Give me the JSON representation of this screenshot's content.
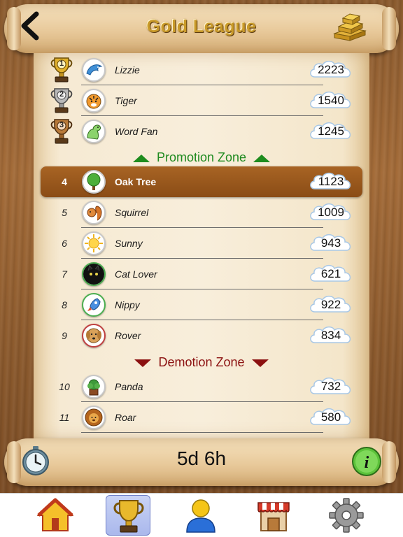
{
  "header": {
    "title": "Gold League",
    "back_icon": "chevron-left-icon",
    "currency_icon": "gold-bars-icon"
  },
  "leaderboard": {
    "top3": [
      {
        "rank": "1",
        "trophy": "gold",
        "name": "Lizzie",
        "score": "2223",
        "avatar": "dolphin"
      },
      {
        "rank": "2",
        "trophy": "silver",
        "name": "Tiger",
        "score": "1540",
        "avatar": "tiger"
      },
      {
        "rank": "3",
        "trophy": "bronze",
        "name": "Word Fan",
        "score": "1245",
        "avatar": "dinosaur"
      }
    ],
    "promotion_label": "Promotion Zone",
    "middle": [
      {
        "rank": "4",
        "name": "Oak Tree",
        "score": "1123",
        "avatar": "tree",
        "highlighted": true
      },
      {
        "rank": "5",
        "name": "Squirrel",
        "score": "1009",
        "avatar": "squirrel"
      },
      {
        "rank": "6",
        "name": "Sunny",
        "score": "943",
        "avatar": "sun"
      },
      {
        "rank": "7",
        "name": "Cat Lover",
        "score": "621",
        "avatar": "cat"
      },
      {
        "rank": "8",
        "name": "Nippy",
        "score": "922",
        "avatar": "rocket"
      },
      {
        "rank": "9",
        "name": "Rover",
        "score": "834",
        "avatar": "dog"
      }
    ],
    "demotion_label": "Demotion Zone",
    "bottom": [
      {
        "rank": "10",
        "name": "Panda",
        "score": "732",
        "avatar": "plant"
      },
      {
        "rank": "11",
        "name": "Roar",
        "score": "580",
        "avatar": "lion"
      }
    ]
  },
  "footer": {
    "time_left": "5d 6h",
    "timer_icon": "stopwatch-icon",
    "info_icon": "info-icon"
  },
  "tabs": [
    {
      "name": "home",
      "icon": "house-icon",
      "active": false
    },
    {
      "name": "leagues",
      "icon": "trophy-icon",
      "active": true
    },
    {
      "name": "profile",
      "icon": "person-icon",
      "active": false
    },
    {
      "name": "shop",
      "icon": "shop-icon",
      "active": false
    },
    {
      "name": "settings",
      "icon": "gear-icon",
      "active": false
    }
  ],
  "colors": {
    "highlight_row": "#8a4c16",
    "promotion": "#1f8a1f",
    "demotion": "#8b1010",
    "title_gold": "#c99a2a"
  }
}
